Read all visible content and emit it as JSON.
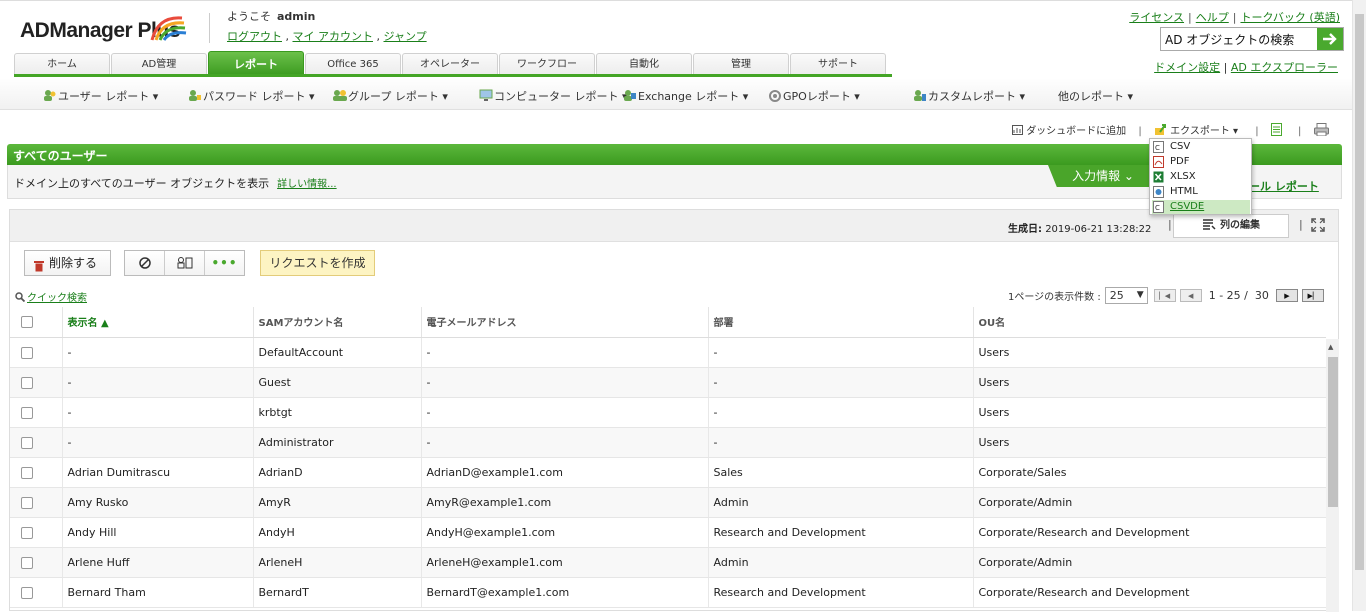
{
  "header": {
    "logo": "ADManager Plus",
    "welcome": "ようこそ",
    "username": "admin",
    "user_links": [
      "ログアウト",
      "マイ アカウント",
      "ジャンプ"
    ],
    "top_links": [
      "ライセンス",
      "ヘルプ",
      "トークバック (英語)"
    ],
    "search_text": "AD オブジェクトの検索",
    "domain_links": [
      "ドメイン設定",
      "AD エクスプローラー"
    ]
  },
  "tabs": [
    "ホーム",
    "AD管理",
    "レポート",
    "Office 365",
    "オペレーター",
    "ワークフロー",
    "自動化",
    "管理",
    "サポート"
  ],
  "active_tab": "レポート",
  "subnav": [
    "ユーザー レポート ▾",
    "パスワード レポート ▾",
    "グループ レポート ▾",
    "コンピューター レポート ▾",
    "Exchange レポート ▾",
    "GPOレポート ▾",
    "カスタムレポート ▾",
    "他のレポート ▾"
  ],
  "actions": {
    "dashboard": "ダッシュボードに追加",
    "export": "エクスポート ▾"
  },
  "export_menu": [
    "CSV",
    "PDF",
    "XLSX",
    "HTML",
    "CSVDE"
  ],
  "export_highlight": "CSVDE",
  "report": {
    "title": "すべてのユーザー",
    "description": "ドメイン上のすべてのユーザー オブジェクトを表示",
    "more_info": "詳しい情報...",
    "input_info": "入力情報 ⌄",
    "schedule_link": "ュール レポート",
    "generated_label": "生成日:",
    "generated_value": "2019-06-21 13:28:22",
    "edit_columns": "列の編集",
    "delete": "削除する",
    "request": "リクエストを作成",
    "quick_search": "クイック検索",
    "per_page_label": "1ページの表示件数 :",
    "per_page": "25",
    "range": "1 - 25 /",
    "total": "30"
  },
  "table": {
    "columns": [
      "表示名 ▲",
      "SAMアカウント名",
      "電子メールアドレス",
      "部署",
      "OU名"
    ],
    "rows": [
      [
        "-",
        "DefaultAccount",
        "-",
        "-",
        "Users"
      ],
      [
        "-",
        "Guest",
        "-",
        "-",
        "Users"
      ],
      [
        "-",
        "krbtgt",
        "-",
        "-",
        "Users"
      ],
      [
        "-",
        "Administrator",
        "-",
        "-",
        "Users"
      ],
      [
        "Adrian Dumitrascu",
        "AdrianD",
        "AdrianD@example1.com",
        "Sales",
        "Corporate/Sales"
      ],
      [
        "Amy Rusko",
        "AmyR",
        "AmyR@example1.com",
        "Admin",
        "Corporate/Admin"
      ],
      [
        "Andy Hill",
        "AndyH",
        "AndyH@example1.com",
        "Research and Development",
        "Corporate/Research and Development"
      ],
      [
        "Arlene Huff",
        "ArleneH",
        "ArleneH@example1.com",
        "Admin",
        "Corporate/Admin"
      ],
      [
        "Bernard Tham",
        "BernardT",
        "BernardT@example1.com",
        "Research and Development",
        "Corporate/Research and Development"
      ]
    ]
  },
  "colors": {
    "accent": "#44a526",
    "link": "#1a7f1a",
    "request_bg": "#fdf4c3"
  }
}
